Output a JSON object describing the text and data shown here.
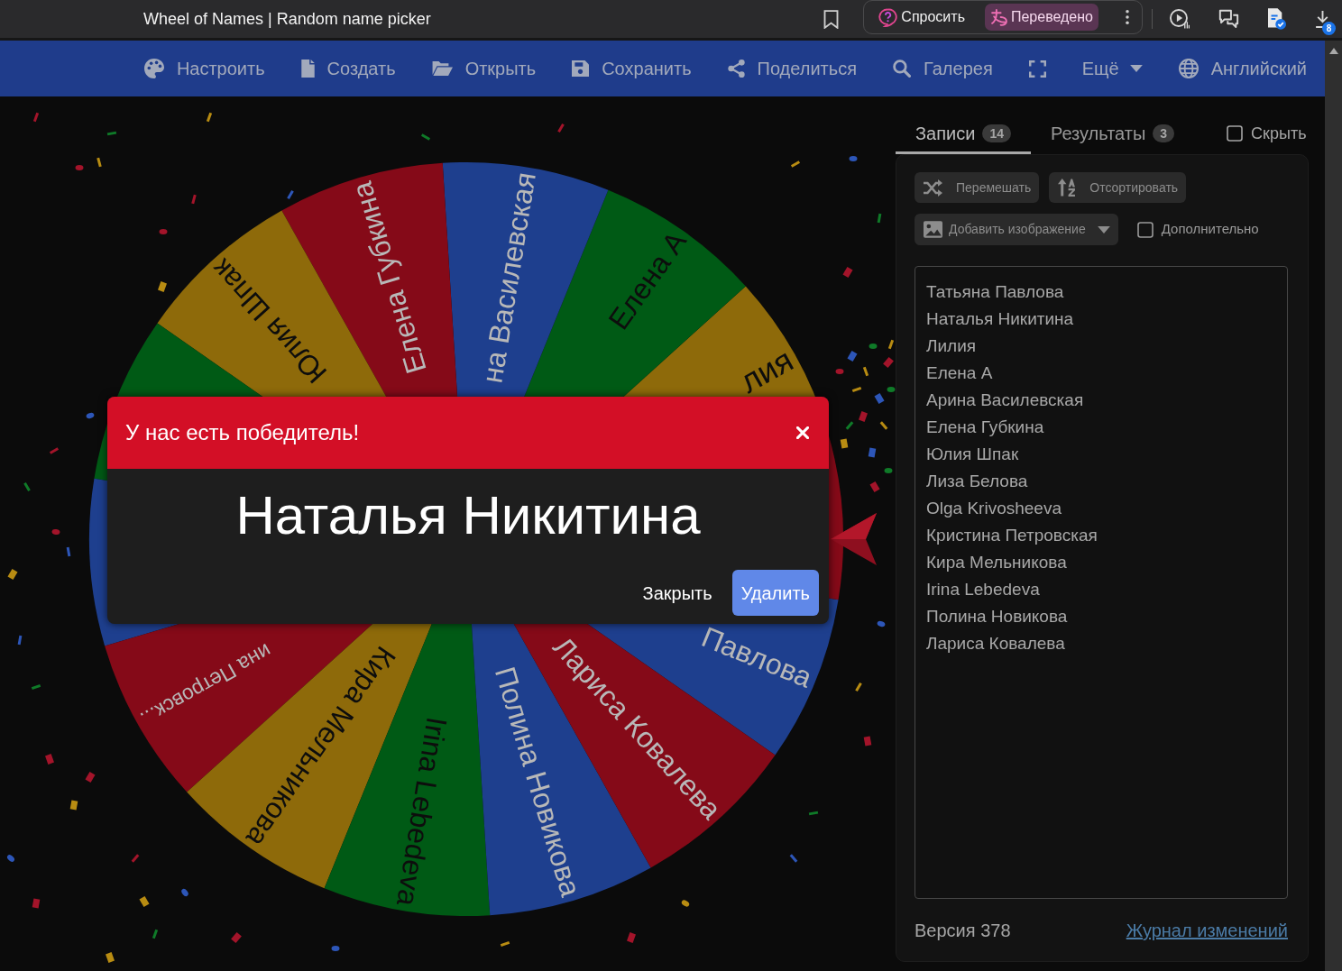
{
  "browser": {
    "tab_title": "Wheel of Names | Random name picker",
    "assistant_buttons": [
      {
        "kind": "ask",
        "label": "Спросить",
        "active": false
      },
      {
        "kind": "translate",
        "label": "Переведено",
        "active": true
      }
    ],
    "downloads_badge": "8"
  },
  "navbar": {
    "items": [
      {
        "kind": "palette",
        "label": "Настроить"
      },
      {
        "kind": "file",
        "label": "Создать"
      },
      {
        "kind": "folder",
        "label": "Открыть"
      },
      {
        "kind": "save",
        "label": "Сохранить"
      },
      {
        "kind": "share",
        "label": "Поделиться"
      },
      {
        "kind": "search",
        "label": "Галерея"
      },
      {
        "kind": "fullscreen"
      },
      {
        "kind": "dropdown",
        "label": "Ещё"
      },
      {
        "kind": "globe",
        "label": "Английский"
      }
    ]
  },
  "wheel": {
    "segments": [
      {
        "label": "Павлова",
        "color": "#1e3f8e"
      },
      {
        "color": "#850a18"
      },
      {
        "label": "лия",
        "color": "#8e6a0a"
      },
      {
        "label": "Елена А",
        "color": "#005a15"
      },
      {
        "label": "на Василевская",
        "color": "#1e3f8e"
      },
      {
        "label": "Елена Губкина",
        "color": "#850a18"
      },
      {
        "label": "Юлия Шпак",
        "color": "#8e6a0a"
      },
      {
        "color": "#005a15"
      },
      {
        "color": "#1e3f8e"
      },
      {
        "label": "ина Петровск...",
        "color": "#850a18"
      },
      {
        "label": "Кира Мельникова",
        "color": "#8e6a0a"
      },
      {
        "label": "Irina Lebedeva",
        "color": "#005a15"
      },
      {
        "label": "Полина Новикова",
        "color": "#1e3f8e"
      },
      {
        "label": "Лариса Ковалева",
        "color": "#850a18"
      }
    ]
  },
  "winner_dialog": {
    "title": "У нас есть победитель!",
    "winner": "Наталья Никитина",
    "buttons": [
      {
        "kind": "link",
        "label": "Закрыть"
      },
      {
        "kind": "primary",
        "label": "Удалить"
      }
    ]
  },
  "panel": {
    "tabs": [
      {
        "label": "Записи",
        "count": "14",
        "selected": true
      },
      {
        "label": "Результаты",
        "count": "3",
        "selected": false
      }
    ],
    "hide_checkbox": {
      "label": "Скрыть",
      "checked": false
    },
    "actions": [
      {
        "kind": "shuffle",
        "label": "Перемешать"
      },
      {
        "kind": "sort",
        "label": "Отсортировать"
      }
    ],
    "image_dropdown": {
      "label": "Добавить изображение"
    },
    "advanced_checkbox": {
      "label": "Дополнительно",
      "checked": false
    },
    "entries": [
      "Татьяна Павлова",
      "Наталья Никитина",
      "Лилия",
      "Елена А",
      "Арина Василевская",
      "Елена Губкина",
      "Юлия Шпак",
      "Лиза Белова",
      "Olga Krivosheeva",
      "Кристина Петровская",
      "Кира Мельникова",
      "Irina Lebedeva",
      "Полина Новикова",
      "Лариса Ковалева"
    ],
    "version": "Версия 378",
    "changelog_link": "Журнал изменений"
  }
}
